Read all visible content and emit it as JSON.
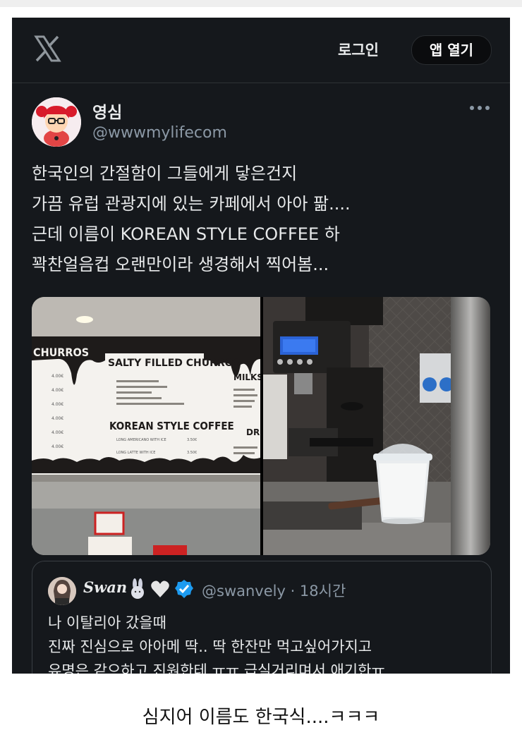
{
  "header": {
    "logo": "x-logo-icon",
    "login_label": "로그인",
    "open_app_label": "앱 열기"
  },
  "tweet": {
    "display_name": "영심",
    "handle": "@wwwmylifecom",
    "more_icon": "more-horizontal-icon",
    "lines": [
      "한국인의 간절함이 그들에게 닿은건지",
      "가끔 유럽 관광지에 있는 카페에서 아아 팖....",
      "근데 이름이 KOREAN STYLE COFFEE 하",
      "꽉찬얼음컵 오랜만이라 생경해서 찍어봄..."
    ]
  },
  "media": {
    "left_photo": {
      "menu_left_title": "CHURROS",
      "menu_title": "SALTY FILLED CHURROS",
      "menu_right_title": "MILKS",
      "section_title": "KOREAN STYLE COFFEE",
      "item_1": "LONG AMERICANO WITH ICE",
      "item_1_price": "3.50€",
      "item_2": "LONG LATTE WITH ICE",
      "item_2_price": "3.50€",
      "right_section": "DRI",
      "prices": [
        "4.00€",
        "4.00€",
        "4.00€",
        "4.00€",
        "4.00€",
        "4.00€"
      ]
    },
    "right_photo": {
      "description_icon": "coffee-grinder-and-iced-cup-photo"
    }
  },
  "quote": {
    "display_name": "Swan",
    "handle": "@swanvely · 18시간",
    "emoji_1": "rabbit-icon",
    "emoji_2": "white-heart-icon",
    "verified": "verified-badge-icon",
    "lines": [
      "나 이탈리아 갔을때",
      "진짜 진심으로 아아메 딱.. 딱 한잔만 먹고싶어가지고",
      "유명은 같으하고 진원한테 ㅠㅠ 급실거리며서 애기한ㅠ"
    ]
  },
  "caption": "심지어 이름도 한국식....ㅋㅋㅋ"
}
